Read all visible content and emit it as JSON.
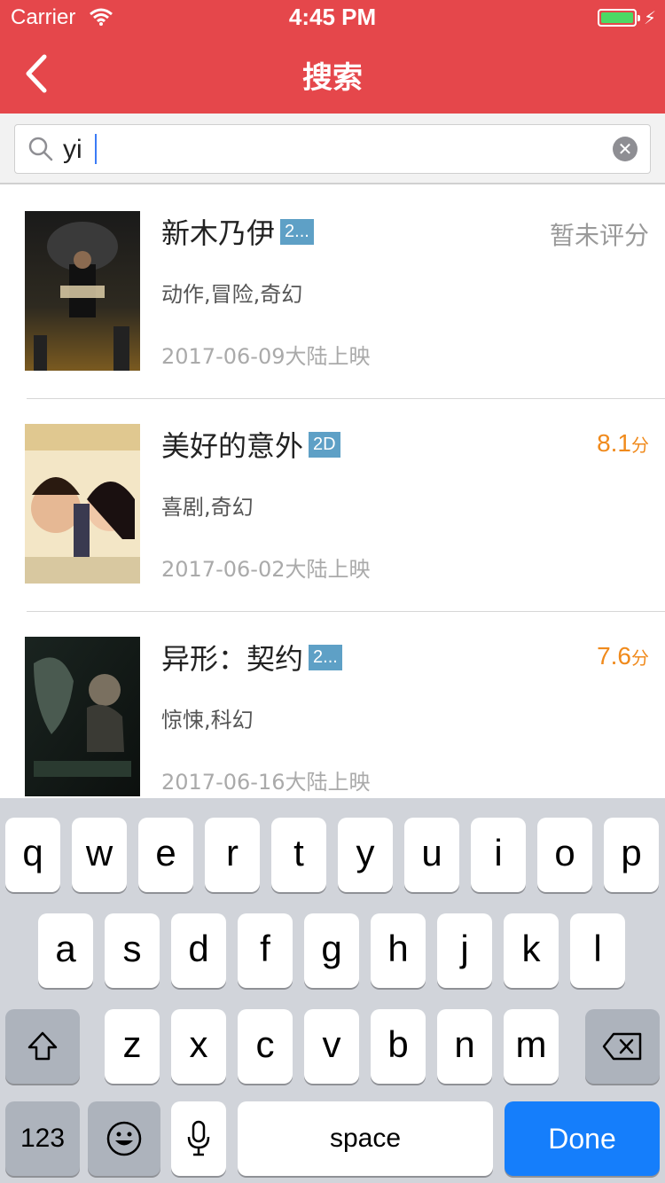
{
  "status_bar": {
    "carrier": "Carrier",
    "time": "4:45 PM"
  },
  "nav": {
    "title": "搜索",
    "back_icon": "chevron-left-icon"
  },
  "search": {
    "value": "yi",
    "search_icon": "search-icon",
    "clear_icon": "clear-icon"
  },
  "movies": [
    {
      "name": "新木乃伊",
      "badge": "2...",
      "genre": "动作,冒险,奇幻",
      "release": "2017-06-09大陆上映",
      "score": "暂未评分",
      "score_unit": ""
    },
    {
      "name": "美好的意外",
      "badge": "2D",
      "genre": "喜剧,奇幻",
      "release": "2017-06-02大陆上映",
      "score": "8.1",
      "score_unit": "分"
    },
    {
      "name": "异形：契约",
      "badge": "2...",
      "genre": "惊悚,科幻",
      "release": "2017-06-16大陆上映",
      "score": "7.6",
      "score_unit": "分"
    }
  ],
  "keyboard": {
    "row1": [
      "q",
      "w",
      "e",
      "r",
      "t",
      "y",
      "u",
      "i",
      "o",
      "p"
    ],
    "row2": [
      "a",
      "s",
      "d",
      "f",
      "g",
      "h",
      "j",
      "k",
      "l"
    ],
    "row3": [
      "z",
      "x",
      "c",
      "v",
      "b",
      "n",
      "m"
    ],
    "numbers_label": "123",
    "space_label": "space",
    "done_label": "Done"
  },
  "colors": {
    "accent": "#e5474b",
    "score": "#f08a1c",
    "done": "#157efb"
  }
}
